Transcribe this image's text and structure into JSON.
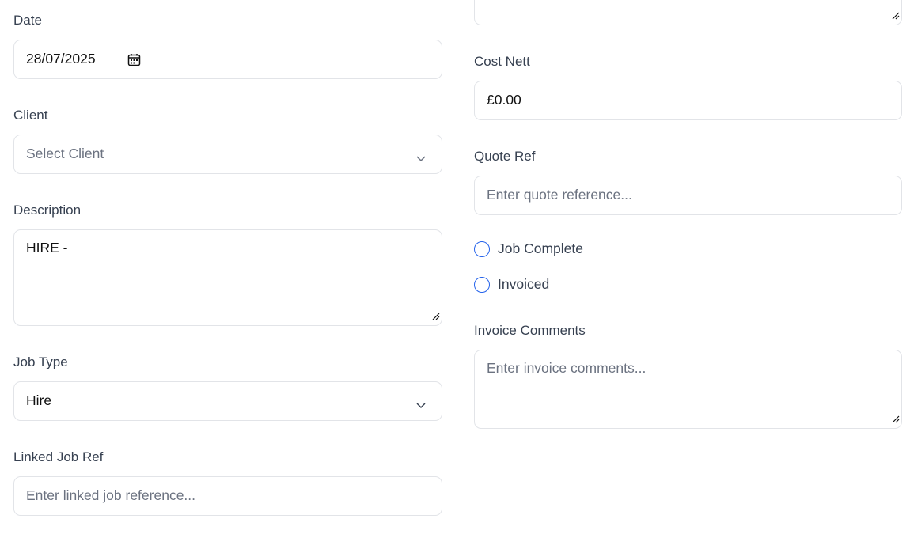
{
  "left": {
    "date": {
      "label": "Date",
      "value": "28/07/2025"
    },
    "client": {
      "label": "Client",
      "placeholder": "Select Client"
    },
    "description": {
      "label": "Description",
      "value": "HIRE -"
    },
    "job_type": {
      "label": "Job Type",
      "value": "Hire"
    },
    "linked_job_ref": {
      "label": "Linked Job Ref",
      "placeholder": "Enter linked job reference..."
    }
  },
  "right": {
    "cost_nett": {
      "label": "Cost Nett",
      "value": "£0.00"
    },
    "quote_ref": {
      "label": "Quote Ref",
      "placeholder": "Enter quote reference..."
    },
    "job_complete": {
      "label": "Job Complete",
      "checked": false
    },
    "invoiced": {
      "label": "Invoiced",
      "checked": false
    },
    "invoice_comments": {
      "label": "Invoice Comments",
      "placeholder": "Enter invoice comments..."
    }
  },
  "colors": {
    "accent": "#2563eb",
    "border": "#e2e4e8",
    "placeholder": "#6b7280"
  },
  "icons": [
    "calendar-icon",
    "chevron-down-icon",
    "resize-grip-icon"
  ]
}
